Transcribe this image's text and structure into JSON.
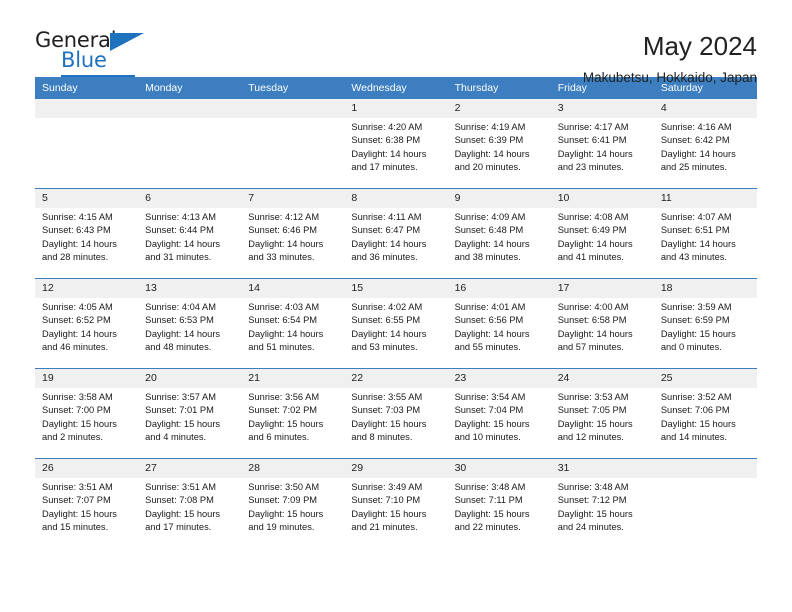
{
  "logo": {
    "word_one": "General",
    "word_two": "Blue",
    "triangle_icon": "triangle-icon",
    "accent_color": "#1f72bd"
  },
  "header": {
    "title": "May 2024",
    "subtitle": "Makubetsu, Hokkaido, Japan"
  },
  "calendar": {
    "header_background": "#3c7ebf",
    "daynum_background": "#f0f0f0",
    "weekday_headers": [
      "Sunday",
      "Monday",
      "Tuesday",
      "Wednesday",
      "Thursday",
      "Friday",
      "Saturday"
    ],
    "weeks": [
      [
        {
          "day": "",
          "empty": true,
          "sunrise": "",
          "sunset": "",
          "daylight_line1": "",
          "daylight_line2": ""
        },
        {
          "day": "",
          "empty": true,
          "sunrise": "",
          "sunset": "",
          "daylight_line1": "",
          "daylight_line2": ""
        },
        {
          "day": "",
          "empty": true,
          "sunrise": "",
          "sunset": "",
          "daylight_line1": "",
          "daylight_line2": ""
        },
        {
          "day": "1",
          "empty": false,
          "sunrise": "Sunrise: 4:20 AM",
          "sunset": "Sunset: 6:38 PM",
          "daylight_line1": "Daylight: 14 hours",
          "daylight_line2": "and 17 minutes."
        },
        {
          "day": "2",
          "empty": false,
          "sunrise": "Sunrise: 4:19 AM",
          "sunset": "Sunset: 6:39 PM",
          "daylight_line1": "Daylight: 14 hours",
          "daylight_line2": "and 20 minutes."
        },
        {
          "day": "3",
          "empty": false,
          "sunrise": "Sunrise: 4:17 AM",
          "sunset": "Sunset: 6:41 PM",
          "daylight_line1": "Daylight: 14 hours",
          "daylight_line2": "and 23 minutes."
        },
        {
          "day": "4",
          "empty": false,
          "sunrise": "Sunrise: 4:16 AM",
          "sunset": "Sunset: 6:42 PM",
          "daylight_line1": "Daylight: 14 hours",
          "daylight_line2": "and 25 minutes."
        }
      ],
      [
        {
          "day": "5",
          "empty": false,
          "sunrise": "Sunrise: 4:15 AM",
          "sunset": "Sunset: 6:43 PM",
          "daylight_line1": "Daylight: 14 hours",
          "daylight_line2": "and 28 minutes."
        },
        {
          "day": "6",
          "empty": false,
          "sunrise": "Sunrise: 4:13 AM",
          "sunset": "Sunset: 6:44 PM",
          "daylight_line1": "Daylight: 14 hours",
          "daylight_line2": "and 31 minutes."
        },
        {
          "day": "7",
          "empty": false,
          "sunrise": "Sunrise: 4:12 AM",
          "sunset": "Sunset: 6:46 PM",
          "daylight_line1": "Daylight: 14 hours",
          "daylight_line2": "and 33 minutes."
        },
        {
          "day": "8",
          "empty": false,
          "sunrise": "Sunrise: 4:11 AM",
          "sunset": "Sunset: 6:47 PM",
          "daylight_line1": "Daylight: 14 hours",
          "daylight_line2": "and 36 minutes."
        },
        {
          "day": "9",
          "empty": false,
          "sunrise": "Sunrise: 4:09 AM",
          "sunset": "Sunset: 6:48 PM",
          "daylight_line1": "Daylight: 14 hours",
          "daylight_line2": "and 38 minutes."
        },
        {
          "day": "10",
          "empty": false,
          "sunrise": "Sunrise: 4:08 AM",
          "sunset": "Sunset: 6:49 PM",
          "daylight_line1": "Daylight: 14 hours",
          "daylight_line2": "and 41 minutes."
        },
        {
          "day": "11",
          "empty": false,
          "sunrise": "Sunrise: 4:07 AM",
          "sunset": "Sunset: 6:51 PM",
          "daylight_line1": "Daylight: 14 hours",
          "daylight_line2": "and 43 minutes."
        }
      ],
      [
        {
          "day": "12",
          "empty": false,
          "sunrise": "Sunrise: 4:05 AM",
          "sunset": "Sunset: 6:52 PM",
          "daylight_line1": "Daylight: 14 hours",
          "daylight_line2": "and 46 minutes."
        },
        {
          "day": "13",
          "empty": false,
          "sunrise": "Sunrise: 4:04 AM",
          "sunset": "Sunset: 6:53 PM",
          "daylight_line1": "Daylight: 14 hours",
          "daylight_line2": "and 48 minutes."
        },
        {
          "day": "14",
          "empty": false,
          "sunrise": "Sunrise: 4:03 AM",
          "sunset": "Sunset: 6:54 PM",
          "daylight_line1": "Daylight: 14 hours",
          "daylight_line2": "and 51 minutes."
        },
        {
          "day": "15",
          "empty": false,
          "sunrise": "Sunrise: 4:02 AM",
          "sunset": "Sunset: 6:55 PM",
          "daylight_line1": "Daylight: 14 hours",
          "daylight_line2": "and 53 minutes."
        },
        {
          "day": "16",
          "empty": false,
          "sunrise": "Sunrise: 4:01 AM",
          "sunset": "Sunset: 6:56 PM",
          "daylight_line1": "Daylight: 14 hours",
          "daylight_line2": "and 55 minutes."
        },
        {
          "day": "17",
          "empty": false,
          "sunrise": "Sunrise: 4:00 AM",
          "sunset": "Sunset: 6:58 PM",
          "daylight_line1": "Daylight: 14 hours",
          "daylight_line2": "and 57 minutes."
        },
        {
          "day": "18",
          "empty": false,
          "sunrise": "Sunrise: 3:59 AM",
          "sunset": "Sunset: 6:59 PM",
          "daylight_line1": "Daylight: 15 hours",
          "daylight_line2": "and 0 minutes."
        }
      ],
      [
        {
          "day": "19",
          "empty": false,
          "sunrise": "Sunrise: 3:58 AM",
          "sunset": "Sunset: 7:00 PM",
          "daylight_line1": "Daylight: 15 hours",
          "daylight_line2": "and 2 minutes."
        },
        {
          "day": "20",
          "empty": false,
          "sunrise": "Sunrise: 3:57 AM",
          "sunset": "Sunset: 7:01 PM",
          "daylight_line1": "Daylight: 15 hours",
          "daylight_line2": "and 4 minutes."
        },
        {
          "day": "21",
          "empty": false,
          "sunrise": "Sunrise: 3:56 AM",
          "sunset": "Sunset: 7:02 PM",
          "daylight_line1": "Daylight: 15 hours",
          "daylight_line2": "and 6 minutes."
        },
        {
          "day": "22",
          "empty": false,
          "sunrise": "Sunrise: 3:55 AM",
          "sunset": "Sunset: 7:03 PM",
          "daylight_line1": "Daylight: 15 hours",
          "daylight_line2": "and 8 minutes."
        },
        {
          "day": "23",
          "empty": false,
          "sunrise": "Sunrise: 3:54 AM",
          "sunset": "Sunset: 7:04 PM",
          "daylight_line1": "Daylight: 15 hours",
          "daylight_line2": "and 10 minutes."
        },
        {
          "day": "24",
          "empty": false,
          "sunrise": "Sunrise: 3:53 AM",
          "sunset": "Sunset: 7:05 PM",
          "daylight_line1": "Daylight: 15 hours",
          "daylight_line2": "and 12 minutes."
        },
        {
          "day": "25",
          "empty": false,
          "sunrise": "Sunrise: 3:52 AM",
          "sunset": "Sunset: 7:06 PM",
          "daylight_line1": "Daylight: 15 hours",
          "daylight_line2": "and 14 minutes."
        }
      ],
      [
        {
          "day": "26",
          "empty": false,
          "sunrise": "Sunrise: 3:51 AM",
          "sunset": "Sunset: 7:07 PM",
          "daylight_line1": "Daylight: 15 hours",
          "daylight_line2": "and 15 minutes."
        },
        {
          "day": "27",
          "empty": false,
          "sunrise": "Sunrise: 3:51 AM",
          "sunset": "Sunset: 7:08 PM",
          "daylight_line1": "Daylight: 15 hours",
          "daylight_line2": "and 17 minutes."
        },
        {
          "day": "28",
          "empty": false,
          "sunrise": "Sunrise: 3:50 AM",
          "sunset": "Sunset: 7:09 PM",
          "daylight_line1": "Daylight: 15 hours",
          "daylight_line2": "and 19 minutes."
        },
        {
          "day": "29",
          "empty": false,
          "sunrise": "Sunrise: 3:49 AM",
          "sunset": "Sunset: 7:10 PM",
          "daylight_line1": "Daylight: 15 hours",
          "daylight_line2": "and 21 minutes."
        },
        {
          "day": "30",
          "empty": false,
          "sunrise": "Sunrise: 3:48 AM",
          "sunset": "Sunset: 7:11 PM",
          "daylight_line1": "Daylight: 15 hours",
          "daylight_line2": "and 22 minutes."
        },
        {
          "day": "31",
          "empty": false,
          "sunrise": "Sunrise: 3:48 AM",
          "sunset": "Sunset: 7:12 PM",
          "daylight_line1": "Daylight: 15 hours",
          "daylight_line2": "and 24 minutes."
        },
        {
          "day": "",
          "empty": true,
          "sunrise": "",
          "sunset": "",
          "daylight_line1": "",
          "daylight_line2": ""
        }
      ]
    ]
  }
}
